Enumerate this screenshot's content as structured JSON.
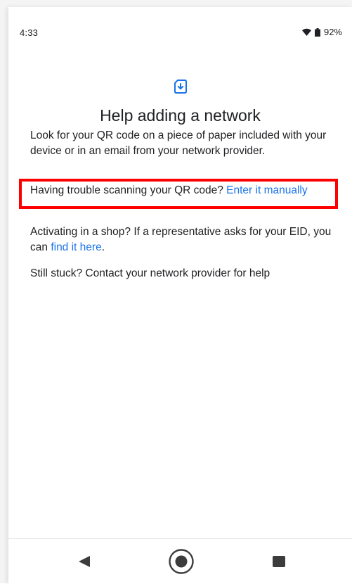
{
  "status_bar": {
    "time": "4:33",
    "battery": "92%",
    "icons": [
      "wifi-icon",
      "battery-icon"
    ]
  },
  "header": {
    "icon": "sim-download-icon",
    "title": "Help adding a network"
  },
  "content": {
    "p1": "Look for your QR code on a piece of paper included with your device or in an email from your network provider.",
    "p2_text": "Having trouble scanning your QR code? ",
    "p2_link": "Enter it manually",
    "p3_text": "Activating in a shop? If a representative asks for your EID, you can ",
    "p3_link": "find it here",
    "p3_end": ".",
    "p4": "Still stuck? Contact your network provider for help"
  },
  "nav_bar": {
    "icons": [
      "back-icon",
      "home-icon",
      "recents-icon"
    ]
  },
  "colors": {
    "link": "#1a73e8",
    "text": "#202124",
    "highlight": "#ff0000"
  }
}
